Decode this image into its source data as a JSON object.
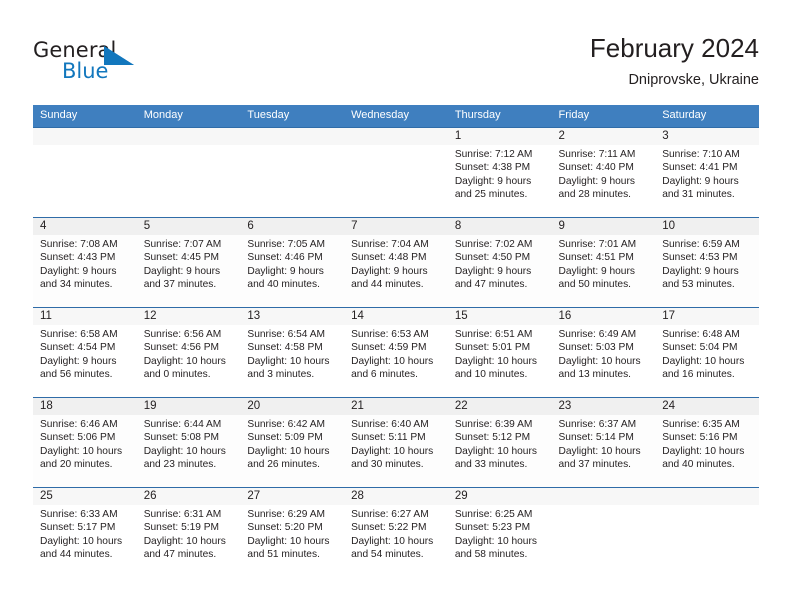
{
  "brand": {
    "word_general": "General",
    "word_blue": "Blue",
    "logo_color": "#1277bd"
  },
  "header": {
    "title": "February 2024",
    "subtitle": "Dniprovske, Ukraine"
  },
  "theme": {
    "header_blue": "#3f7fbf",
    "grid_line": "#2f6ca8",
    "daynum_band": "#f0f0f0",
    "text": "#231f20"
  },
  "weekdays": [
    "Sunday",
    "Monday",
    "Tuesday",
    "Wednesday",
    "Thursday",
    "Friday",
    "Saturday"
  ],
  "labels": {
    "sunrise_prefix": "Sunrise:",
    "sunset_prefix": "Sunset:",
    "daylight_prefix": "Daylight:"
  },
  "weeks": [
    [
      {
        "day": "",
        "kind": "empty"
      },
      {
        "day": "",
        "kind": "empty"
      },
      {
        "day": "",
        "kind": "empty"
      },
      {
        "day": "",
        "kind": "empty"
      },
      {
        "day": "1",
        "kind": "day",
        "sunrise": "Sunrise: 7:12 AM",
        "sunset": "Sunset: 4:38 PM",
        "daylight1": "Daylight: 9 hours",
        "daylight2": "and 25 minutes."
      },
      {
        "day": "2",
        "kind": "day",
        "sunrise": "Sunrise: 7:11 AM",
        "sunset": "Sunset: 4:40 PM",
        "daylight1": "Daylight: 9 hours",
        "daylight2": "and 28 minutes."
      },
      {
        "day": "3",
        "kind": "day",
        "sunrise": "Sunrise: 7:10 AM",
        "sunset": "Sunset: 4:41 PM",
        "daylight1": "Daylight: 9 hours",
        "daylight2": "and 31 minutes."
      }
    ],
    [
      {
        "day": "4",
        "kind": "day",
        "sunrise": "Sunrise: 7:08 AM",
        "sunset": "Sunset: 4:43 PM",
        "daylight1": "Daylight: 9 hours",
        "daylight2": "and 34 minutes."
      },
      {
        "day": "5",
        "kind": "day",
        "sunrise": "Sunrise: 7:07 AM",
        "sunset": "Sunset: 4:45 PM",
        "daylight1": "Daylight: 9 hours",
        "daylight2": "and 37 minutes."
      },
      {
        "day": "6",
        "kind": "day",
        "sunrise": "Sunrise: 7:05 AM",
        "sunset": "Sunset: 4:46 PM",
        "daylight1": "Daylight: 9 hours",
        "daylight2": "and 40 minutes."
      },
      {
        "day": "7",
        "kind": "day",
        "sunrise": "Sunrise: 7:04 AM",
        "sunset": "Sunset: 4:48 PM",
        "daylight1": "Daylight: 9 hours",
        "daylight2": "and 44 minutes."
      },
      {
        "day": "8",
        "kind": "day",
        "sunrise": "Sunrise: 7:02 AM",
        "sunset": "Sunset: 4:50 PM",
        "daylight1": "Daylight: 9 hours",
        "daylight2": "and 47 minutes."
      },
      {
        "day": "9",
        "kind": "day",
        "sunrise": "Sunrise: 7:01 AM",
        "sunset": "Sunset: 4:51 PM",
        "daylight1": "Daylight: 9 hours",
        "daylight2": "and 50 minutes."
      },
      {
        "day": "10",
        "kind": "day",
        "sunrise": "Sunrise: 6:59 AM",
        "sunset": "Sunset: 4:53 PM",
        "daylight1": "Daylight: 9 hours",
        "daylight2": "and 53 minutes."
      }
    ],
    [
      {
        "day": "11",
        "kind": "day",
        "sunrise": "Sunrise: 6:58 AM",
        "sunset": "Sunset: 4:54 PM",
        "daylight1": "Daylight: 9 hours",
        "daylight2": "and 56 minutes."
      },
      {
        "day": "12",
        "kind": "day",
        "sunrise": "Sunrise: 6:56 AM",
        "sunset": "Sunset: 4:56 PM",
        "daylight1": "Daylight: 10 hours",
        "daylight2": "and 0 minutes."
      },
      {
        "day": "13",
        "kind": "day",
        "sunrise": "Sunrise: 6:54 AM",
        "sunset": "Sunset: 4:58 PM",
        "daylight1": "Daylight: 10 hours",
        "daylight2": "and 3 minutes."
      },
      {
        "day": "14",
        "kind": "day",
        "sunrise": "Sunrise: 6:53 AM",
        "sunset": "Sunset: 4:59 PM",
        "daylight1": "Daylight: 10 hours",
        "daylight2": "and 6 minutes."
      },
      {
        "day": "15",
        "kind": "day",
        "sunrise": "Sunrise: 6:51 AM",
        "sunset": "Sunset: 5:01 PM",
        "daylight1": "Daylight: 10 hours",
        "daylight2": "and 10 minutes."
      },
      {
        "day": "16",
        "kind": "day",
        "sunrise": "Sunrise: 6:49 AM",
        "sunset": "Sunset: 5:03 PM",
        "daylight1": "Daylight: 10 hours",
        "daylight2": "and 13 minutes."
      },
      {
        "day": "17",
        "kind": "day",
        "sunrise": "Sunrise: 6:48 AM",
        "sunset": "Sunset: 5:04 PM",
        "daylight1": "Daylight: 10 hours",
        "daylight2": "and 16 minutes."
      }
    ],
    [
      {
        "day": "18",
        "kind": "day",
        "sunrise": "Sunrise: 6:46 AM",
        "sunset": "Sunset: 5:06 PM",
        "daylight1": "Daylight: 10 hours",
        "daylight2": "and 20 minutes."
      },
      {
        "day": "19",
        "kind": "day",
        "sunrise": "Sunrise: 6:44 AM",
        "sunset": "Sunset: 5:08 PM",
        "daylight1": "Daylight: 10 hours",
        "daylight2": "and 23 minutes."
      },
      {
        "day": "20",
        "kind": "day",
        "sunrise": "Sunrise: 6:42 AM",
        "sunset": "Sunset: 5:09 PM",
        "daylight1": "Daylight: 10 hours",
        "daylight2": "and 26 minutes."
      },
      {
        "day": "21",
        "kind": "day",
        "sunrise": "Sunrise: 6:40 AM",
        "sunset": "Sunset: 5:11 PM",
        "daylight1": "Daylight: 10 hours",
        "daylight2": "and 30 minutes."
      },
      {
        "day": "22",
        "kind": "day",
        "sunrise": "Sunrise: 6:39 AM",
        "sunset": "Sunset: 5:12 PM",
        "daylight1": "Daylight: 10 hours",
        "daylight2": "and 33 minutes."
      },
      {
        "day": "23",
        "kind": "day",
        "sunrise": "Sunrise: 6:37 AM",
        "sunset": "Sunset: 5:14 PM",
        "daylight1": "Daylight: 10 hours",
        "daylight2": "and 37 minutes."
      },
      {
        "day": "24",
        "kind": "day",
        "sunrise": "Sunrise: 6:35 AM",
        "sunset": "Sunset: 5:16 PM",
        "daylight1": "Daylight: 10 hours",
        "daylight2": "and 40 minutes."
      }
    ],
    [
      {
        "day": "25",
        "kind": "day",
        "sunrise": "Sunrise: 6:33 AM",
        "sunset": "Sunset: 5:17 PM",
        "daylight1": "Daylight: 10 hours",
        "daylight2": "and 44 minutes."
      },
      {
        "day": "26",
        "kind": "day",
        "sunrise": "Sunrise: 6:31 AM",
        "sunset": "Sunset: 5:19 PM",
        "daylight1": "Daylight: 10 hours",
        "daylight2": "and 47 minutes."
      },
      {
        "day": "27",
        "kind": "day",
        "sunrise": "Sunrise: 6:29 AM",
        "sunset": "Sunset: 5:20 PM",
        "daylight1": "Daylight: 10 hours",
        "daylight2": "and 51 minutes."
      },
      {
        "day": "28",
        "kind": "day",
        "sunrise": "Sunrise: 6:27 AM",
        "sunset": "Sunset: 5:22 PM",
        "daylight1": "Daylight: 10 hours",
        "daylight2": "and 54 minutes."
      },
      {
        "day": "29",
        "kind": "day",
        "sunrise": "Sunrise: 6:25 AM",
        "sunset": "Sunset: 5:23 PM",
        "daylight1": "Daylight: 10 hours",
        "daylight2": "and 58 minutes."
      },
      {
        "day": "",
        "kind": "blank"
      },
      {
        "day": "",
        "kind": "blank"
      }
    ]
  ]
}
